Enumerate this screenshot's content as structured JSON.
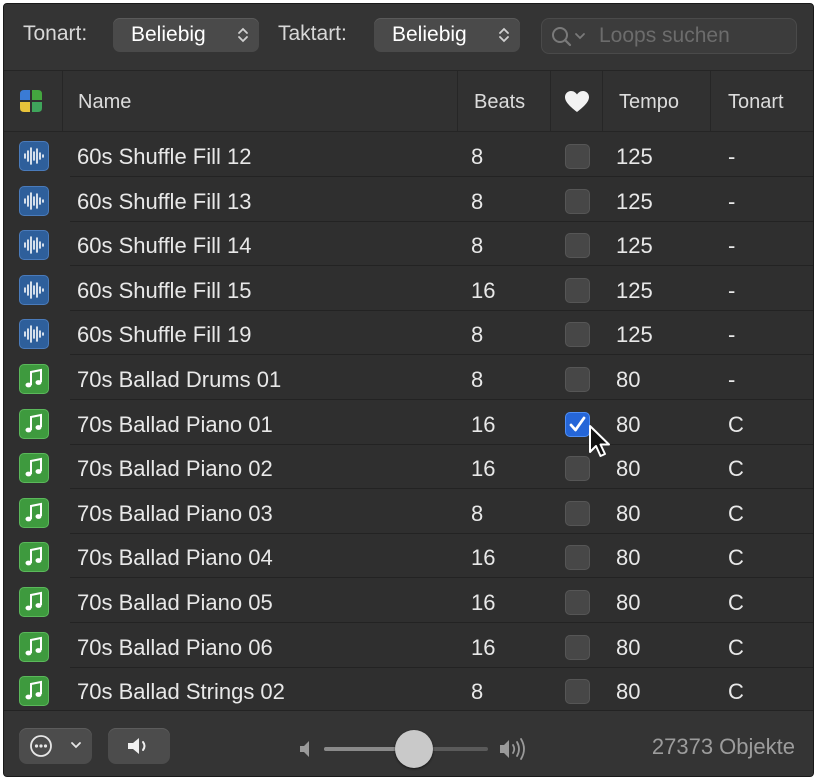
{
  "filters": {
    "key_label": "Tonart:",
    "key_value": "Beliebig",
    "time_label": "Taktart:",
    "time_value": "Beliebig",
    "search_placeholder": "Loops suchen"
  },
  "columns": {
    "name": "Name",
    "beats": "Beats",
    "tempo": "Tempo",
    "key": "Tonart"
  },
  "rows": [
    {
      "type": "audio",
      "name": "60s Shuffle Fill 12",
      "beats": "8",
      "favorite": false,
      "tempo": "125",
      "key": "-"
    },
    {
      "type": "audio",
      "name": "60s Shuffle Fill 13",
      "beats": "8",
      "favorite": false,
      "tempo": "125",
      "key": "-"
    },
    {
      "type": "audio",
      "name": "60s Shuffle Fill 14",
      "beats": "8",
      "favorite": false,
      "tempo": "125",
      "key": "-"
    },
    {
      "type": "audio",
      "name": "60s Shuffle Fill 15",
      "beats": "16",
      "favorite": false,
      "tempo": "125",
      "key": "-"
    },
    {
      "type": "audio",
      "name": "60s Shuffle Fill 19",
      "beats": "8",
      "favorite": false,
      "tempo": "125",
      "key": "-"
    },
    {
      "type": "midi",
      "name": "70s Ballad Drums 01",
      "beats": "8",
      "favorite": false,
      "tempo": "80",
      "key": "-"
    },
    {
      "type": "midi",
      "name": "70s Ballad Piano 01",
      "beats": "16",
      "favorite": true,
      "tempo": "80",
      "key": "C"
    },
    {
      "type": "midi",
      "name": "70s Ballad Piano 02",
      "beats": "16",
      "favorite": false,
      "tempo": "80",
      "key": "C"
    },
    {
      "type": "midi",
      "name": "70s Ballad Piano 03",
      "beats": "8",
      "favorite": false,
      "tempo": "80",
      "key": "C"
    },
    {
      "type": "midi",
      "name": "70s Ballad Piano 04",
      "beats": "16",
      "favorite": false,
      "tempo": "80",
      "key": "C"
    },
    {
      "type": "midi",
      "name": "70s Ballad Piano 05",
      "beats": "16",
      "favorite": false,
      "tempo": "80",
      "key": "C"
    },
    {
      "type": "midi",
      "name": "70s Ballad Piano 06",
      "beats": "16",
      "favorite": false,
      "tempo": "80",
      "key": "C"
    },
    {
      "type": "midi",
      "name": "70s Ballad Strings 02",
      "beats": "8",
      "favorite": false,
      "tempo": "80",
      "key": "C"
    }
  ],
  "footer": {
    "object_count": "27373 Objekte",
    "volume_level": 0.55
  },
  "colors": {
    "audio_icon": "#2e5f9b",
    "midi_icon": "#3e9a3e",
    "checked": "#2566d8"
  },
  "icons": {
    "loop_type_filter": "four-color-grid-icon",
    "favorite_column": "heart-icon",
    "audio_loop": "waveform-icon",
    "midi_loop": "music-note-icon",
    "options": "ellipsis-circle-icon",
    "preview": "speaker-icon"
  }
}
